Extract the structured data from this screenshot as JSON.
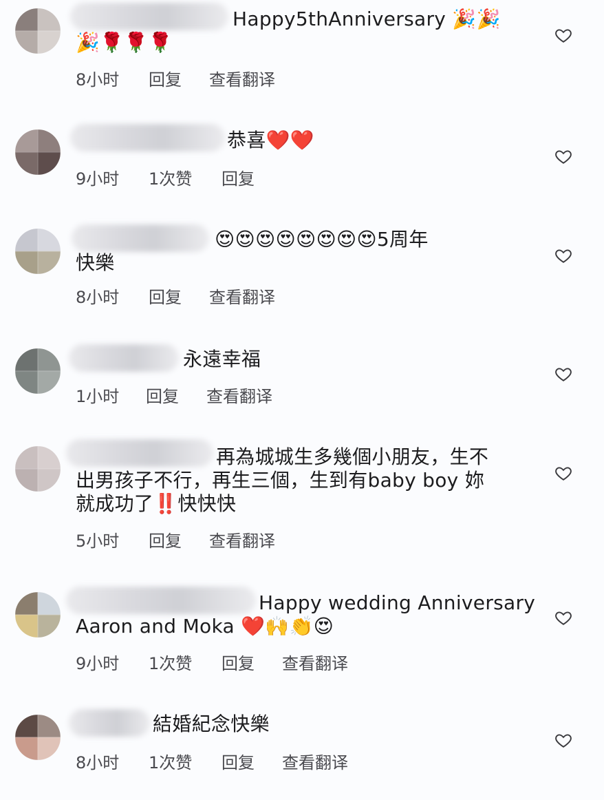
{
  "comments": [
    {
      "text_line1": "Happy5thAnniversary 🎉🎉",
      "text_line2": "🎉🌹🌹🌹",
      "time": "8小时",
      "reply": "回复",
      "translate": "查看翻译"
    },
    {
      "text_line1": "恭喜❤️❤️",
      "time": "9小时",
      "likes": "1次赞",
      "reply": "回复"
    },
    {
      "text_line1": "😍😍😍😍😍😍😍😍5周年",
      "text_line2": "快樂",
      "time": "8小时",
      "reply": "回复",
      "translate": "查看翻译"
    },
    {
      "text_line1": "永遠幸福",
      "time": "1小时",
      "reply": "回复",
      "translate": "查看翻译"
    },
    {
      "text_line1": "再為城城生多幾個小朋友，生不",
      "text_line2": "出男孩子不行，再生三個，生到有baby boy 妳",
      "text_line3": "就成功了‼️快快快",
      "time": "5小时",
      "reply": "回复",
      "translate": "查看翻译"
    },
    {
      "text_line1": "Happy wedding Anniversary",
      "text_line2": "Aaron and Moka ❤️🙌👏😍",
      "time": "9小时",
      "likes": "1次赞",
      "reply": "回复",
      "translate": "查看翻译"
    },
    {
      "text_line1": "結婚紀念快樂",
      "time": "8小时",
      "likes": "1次赞",
      "reply": "回复",
      "translate": "查看翻译"
    }
  ],
  "icons": {
    "like": "heart-outline-icon"
  },
  "colors": {
    "text": "#1c1c1e",
    "meta": "#4a4a4f",
    "background": "#fbfcfe"
  }
}
